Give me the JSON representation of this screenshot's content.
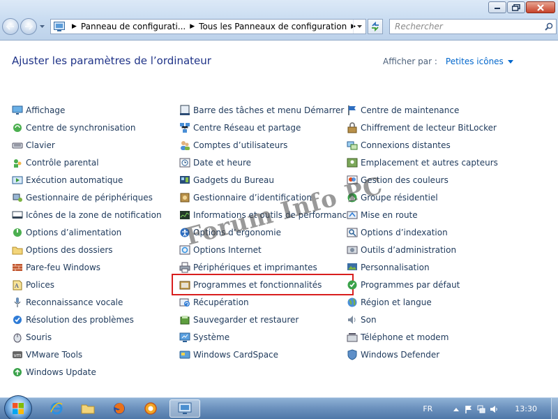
{
  "window": {
    "minimize_label": "minimize",
    "maximize_label": "maximize",
    "close_label": "close"
  },
  "address_bar": {
    "crumbs": [
      "Panneau de configurati...",
      "Tous les Panneaux de configuration"
    ]
  },
  "search": {
    "placeholder": "Rechercher"
  },
  "page": {
    "title": "Ajuster les paramètres de l’ordinateur",
    "view_by_label": "Afficher par :",
    "view_by_value": "Petites icônes"
  },
  "columns": [
    [
      {
        "label": "Affichage",
        "icon": "display-icon"
      },
      {
        "label": "Centre de synchronisation",
        "icon": "sync-icon"
      },
      {
        "label": "Clavier",
        "icon": "keyboard-icon"
      },
      {
        "label": "Contrôle parental",
        "icon": "parental-control-icon"
      },
      {
        "label": "Exécution automatique",
        "icon": "autoplay-icon"
      },
      {
        "label": "Gestionnaire de périphériques",
        "icon": "device-manager-icon"
      },
      {
        "label": "Icônes de la zone de notification",
        "icon": "notification-area-icon"
      },
      {
        "label": "Options d’alimentation",
        "icon": "power-icon"
      },
      {
        "label": "Options des dossiers",
        "icon": "folder-options-icon"
      },
      {
        "label": "Pare-feu Windows",
        "icon": "firewall-icon"
      },
      {
        "label": "Polices",
        "icon": "fonts-icon"
      },
      {
        "label": "Reconnaissance vocale",
        "icon": "microphone-icon"
      },
      {
        "label": "Résolution des problèmes",
        "icon": "troubleshoot-icon"
      },
      {
        "label": "Souris",
        "icon": "mouse-icon"
      },
      {
        "label": "VMware Tools",
        "icon": "vmware-icon"
      },
      {
        "label": "Windows Update",
        "icon": "windows-update-icon"
      }
    ],
    [
      {
        "label": "Barre des tâches et menu Démarrer",
        "icon": "taskbar-icon"
      },
      {
        "label": "Centre Réseau et partage",
        "icon": "network-icon"
      },
      {
        "label": "Comptes d’utilisateurs",
        "icon": "users-icon"
      },
      {
        "label": "Date et heure",
        "icon": "clock-icon"
      },
      {
        "label": "Gadgets du Bureau",
        "icon": "gadgets-icon"
      },
      {
        "label": "Gestionnaire d’identification",
        "icon": "credential-manager-icon"
      },
      {
        "label": "Informations et outils de performance",
        "icon": "performance-icon"
      },
      {
        "label": "Options d’ergonomie",
        "icon": "ease-of-access-icon"
      },
      {
        "label": "Options Internet",
        "icon": "internet-options-icon"
      },
      {
        "label": "Périphériques et imprimantes",
        "icon": "printer-icon"
      },
      {
        "label": "Programmes et fonctionnalités",
        "icon": "programs-icon"
      },
      {
        "label": "Récupération",
        "icon": "recovery-icon"
      },
      {
        "label": "Sauvegarder et restaurer",
        "icon": "backup-icon"
      },
      {
        "label": "Système",
        "icon": "system-icon"
      },
      {
        "label": "Windows CardSpace",
        "icon": "cardspace-icon"
      }
    ],
    [
      {
        "label": "Centre de maintenance",
        "icon": "flag-icon"
      },
      {
        "label": "Chiffrement de lecteur BitLocker",
        "icon": "bitlocker-icon"
      },
      {
        "label": "Connexions distantes",
        "icon": "remote-icon"
      },
      {
        "label": "Emplacement et autres capteurs",
        "icon": "location-icon"
      },
      {
        "label": "Gestion des couleurs",
        "icon": "color-icon"
      },
      {
        "label": "Groupe résidentiel",
        "icon": "homegroup-icon"
      },
      {
        "label": "Mise en route",
        "icon": "getting-started-icon"
      },
      {
        "label": "Options d’indexation",
        "icon": "indexing-icon"
      },
      {
        "label": "Outils d’administration",
        "icon": "admin-tools-icon"
      },
      {
        "label": "Personnalisation",
        "icon": "personalization-icon"
      },
      {
        "label": "Programmes par défaut",
        "icon": "default-programs-icon"
      },
      {
        "label": "Région et langue",
        "icon": "region-icon"
      },
      {
        "label": "Son",
        "icon": "speaker-icon"
      },
      {
        "label": "Téléphone et modem",
        "icon": "phone-icon"
      },
      {
        "label": "Windows Defender",
        "icon": "defender-icon"
      }
    ]
  ],
  "highlighted_item": "Programmes et fonctionnalités",
  "highlight_color": "#d81e1e",
  "watermark": "Forum Info PC",
  "taskbar": {
    "language": "FR",
    "clock": "13:30"
  }
}
